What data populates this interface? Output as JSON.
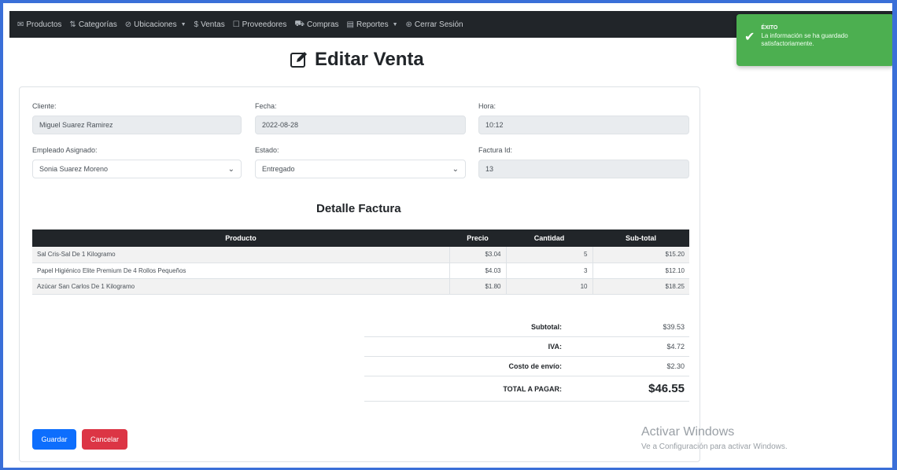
{
  "nav": {
    "items": [
      {
        "icon": "✉",
        "label": "Productos",
        "dropdown": false
      },
      {
        "icon": "⇅",
        "label": "Categorías",
        "dropdown": false
      },
      {
        "icon": "⊘",
        "label": "Ubicaciones",
        "dropdown": true
      },
      {
        "icon": "$",
        "label": "Ventas",
        "dropdown": false
      },
      {
        "icon": "☐",
        "label": "Proveedores",
        "dropdown": false
      },
      {
        "icon": "⛟",
        "label": "Compras",
        "dropdown": false
      },
      {
        "icon": "▤",
        "label": "Reportes",
        "dropdown": true
      },
      {
        "icon": "⊛",
        "label": "Cerrar Sesión",
        "dropdown": false
      }
    ]
  },
  "page": {
    "title": "Editar Venta"
  },
  "form": {
    "cliente_label": "Cliente:",
    "cliente_value": "Miguel Suarez Ramirez",
    "fecha_label": "Fecha:",
    "fecha_value": "2022-08-28",
    "hora_label": "Hora:",
    "hora_value": "10:12",
    "empleado_label": "Empleado Asignado:",
    "empleado_value": "Sonia Suarez Moreno",
    "estado_label": "Estado:",
    "estado_value": "Entregado",
    "factura_label": "Factura Id:",
    "factura_value": "13"
  },
  "detalle": {
    "title": "Detalle Factura",
    "headers": {
      "producto": "Producto",
      "precio": "Precio",
      "cantidad": "Cantidad",
      "subtotal": "Sub-total"
    },
    "rows": [
      {
        "producto": "Sal Cris-Sal De 1 Kilogramo",
        "precio": "$3.04",
        "cantidad": "5",
        "subtotal": "$15.20"
      },
      {
        "producto": "Papel Higiénico Elite Premium De 4 Rollos Pequeños",
        "precio": "$4.03",
        "cantidad": "3",
        "subtotal": "$12.10"
      },
      {
        "producto": "Azúcar San Carlos De 1 Kilogramo",
        "precio": "$1.80",
        "cantidad": "10",
        "subtotal": "$18.25"
      }
    ]
  },
  "totals": {
    "subtotal_label": "Subtotal:",
    "subtotal_value": "$39.53",
    "iva_label": "IVA:",
    "iva_value": "$4.72",
    "envio_label": "Costo de envío:",
    "envio_value": "$2.30",
    "total_label": "TOTAL A PAGAR:",
    "total_value": "$46.55"
  },
  "buttons": {
    "save": "Guardar",
    "cancel": "Cancelar"
  },
  "toast": {
    "title": "ÉXITO",
    "message": "La información se ha guardado satisfactoriamente."
  },
  "watermark": {
    "line1": "Activar Windows",
    "line2": "Ve a Configuración para activar Windows."
  },
  "colors": {
    "navbar": "#212529",
    "primary": "#0d6efd",
    "danger": "#dc3545",
    "success": "#4caf50"
  }
}
